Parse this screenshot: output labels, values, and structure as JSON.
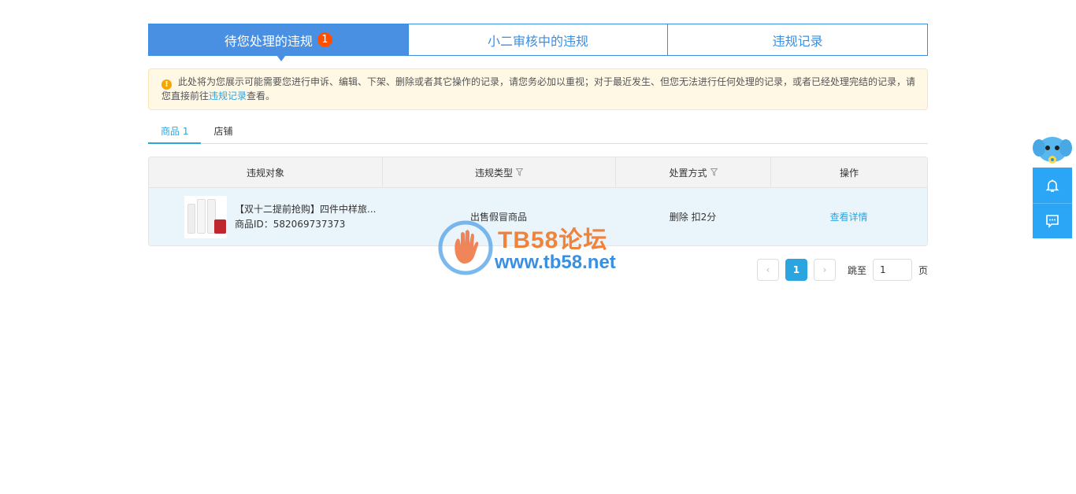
{
  "top_tabs": [
    {
      "label": "待您处理的违规",
      "badge": "1"
    },
    {
      "label": "小二审核中的违规"
    },
    {
      "label": "违规记录"
    }
  ],
  "notice": {
    "text_before": "此处将为您展示可能需要您进行申诉、编辑、下架、删除或者其它操作的记录，请您务必加以重视；对于最近发生、但您无法进行任何处理的记录，或者已经处理完结的记录，请您直接前往",
    "link_text": "违规记录",
    "text_after": "查看。"
  },
  "sub_tabs": [
    {
      "label": "商品 1"
    },
    {
      "label": "店铺"
    }
  ],
  "table": {
    "headers": [
      "违规对象",
      "违规类型",
      "处置方式",
      "操作"
    ],
    "rows": [
      {
        "product_title": "【双十二提前抢购】四件中样旅...",
        "product_id": "商品ID：582069737373",
        "type": "出售假冒商品",
        "action": "删除 扣2分",
        "operation": "查看详情"
      }
    ]
  },
  "pagination": {
    "prev": "‹",
    "current": "1",
    "next": "›",
    "jump_label": "跳至",
    "jump_value": "1",
    "suffix": "页"
  },
  "watermark": {
    "title": "TB58论坛",
    "url": "www.tb58.net"
  },
  "colors": {
    "primary": "#4a90e2",
    "link": "#2ba5e0",
    "badge": "#ff5000",
    "notice_bg": "#fff8e5",
    "row_bg": "#eaf5fb",
    "side": "#2ba5f5"
  }
}
